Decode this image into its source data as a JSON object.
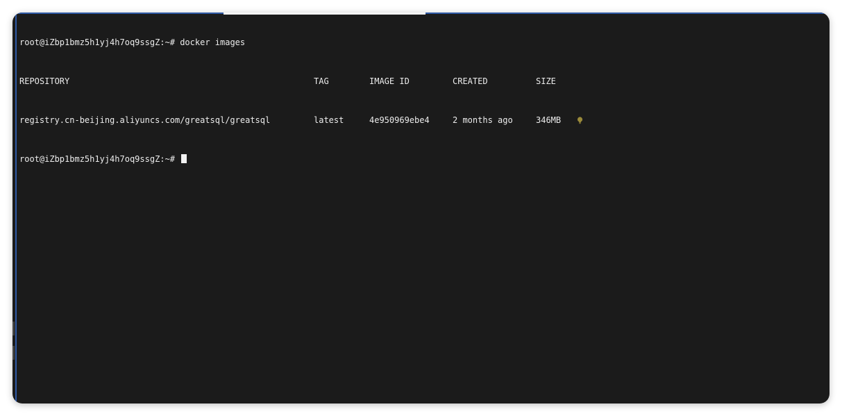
{
  "terminal": {
    "command_prompt": "root@iZbp1bmz5h1yj4h7oq9ssgZ:~#",
    "command": "docker images",
    "headers": {
      "repository": "REPOSITORY",
      "tag": "TAG",
      "image_id": "IMAGE ID",
      "created": "CREATED",
      "size": "SIZE"
    },
    "rows": [
      {
        "repository": "registry.cn-beijing.aliyuncs.com/greatsql/greatsql",
        "tag": "latest",
        "image_id": "4e950969ebe4",
        "created": "2 months ago",
        "size": "346MB"
      }
    ],
    "current_prompt": "root@iZbp1bmz5h1yj4h7oq9ssgZ:~#",
    "hint_icon": "lightbulb-icon",
    "colors": {
      "background": "#1b1b1b",
      "text": "#ececec",
      "accent_edge": "#2f5aa6",
      "bulb": "#9a8a3a"
    }
  }
}
